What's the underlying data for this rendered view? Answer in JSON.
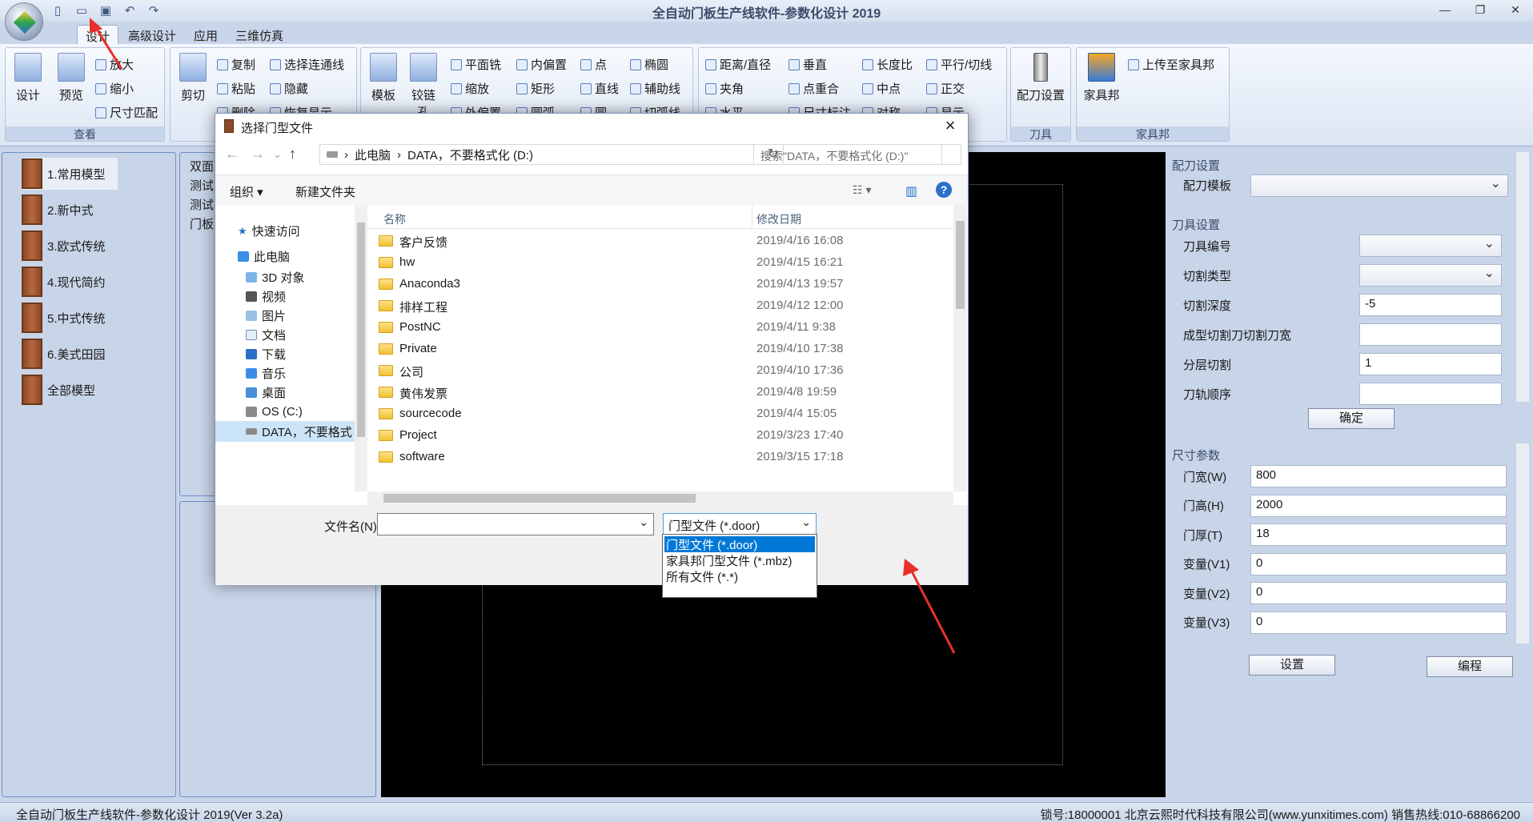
{
  "app": {
    "title": "全自动门板生产线软件-参数化设计 2019",
    "window_controls": [
      "—",
      "❐",
      "✕"
    ]
  },
  "ribbon": {
    "tabs": [
      "设计",
      "高级设计",
      "应用",
      "三维仿真"
    ],
    "groups": {
      "view": {
        "label": "查看",
        "big": [
          "设计",
          "预览"
        ],
        "small": [
          "放大",
          "缩小",
          "尺寸匹配"
        ]
      },
      "edit": {
        "big": [
          "剪切"
        ],
        "small": [
          "复制",
          "粘贴",
          "删除",
          "选择连通线",
          "隐藏",
          "恢复显示"
        ]
      },
      "draw": {
        "big": [
          "模板",
          "铰链孔"
        ],
        "small": [
          "平面铣",
          "缩放",
          "外偏置",
          "内偏置",
          "矩形",
          "圆弧",
          "点",
          "直线",
          "圆",
          "椭圆",
          "辅助线",
          "切弧线"
        ]
      },
      "measure": {
        "small": [
          "距离/直径",
          "夹角",
          "水平",
          "垂直",
          "点重合",
          "尺寸标注",
          "长度比",
          "中点",
          "对称",
          "平行/切线",
          "正交",
          "显示"
        ]
      },
      "tool": {
        "label": "刀具",
        "big": [
          "配刀设置"
        ]
      },
      "jiajubang": {
        "label": "家具邦",
        "big": [
          "家具邦"
        ],
        "small": [
          "上传至家具邦"
        ]
      }
    }
  },
  "left_panel": {
    "items": [
      "1.常用模型",
      "2.新中式",
      "3.欧式传统",
      "4.现代简约",
      "5.中式传统",
      "6.美式田园",
      "全部模型"
    ]
  },
  "mid_panel": {
    "items": [
      "双面",
      "测试",
      "测试",
      "门板"
    ]
  },
  "right_panel": {
    "knife_config": {
      "title": "配刀设置",
      "template_label": "配刀模板",
      "template_value": ""
    },
    "tool_settings": {
      "title": "刀具设置",
      "rows": [
        {
          "label": "刀具编号",
          "value": "",
          "type": "combo"
        },
        {
          "label": "切割类型",
          "value": "",
          "type": "combo"
        },
        {
          "label": "切割深度",
          "value": "-5",
          "type": "input"
        },
        {
          "label": "成型切割刀切割刀宽",
          "value": "",
          "type": "input"
        },
        {
          "label": "分层切割",
          "value": "1",
          "type": "input"
        },
        {
          "label": "刀轨顺序",
          "value": "",
          "type": "input"
        }
      ],
      "confirm": "确定"
    },
    "size_params": {
      "title": "尺寸参数",
      "rows": [
        {
          "label": "门宽(W)",
          "value": "800"
        },
        {
          "label": "门高(H)",
          "value": "2000"
        },
        {
          "label": "门厚(T)",
          "value": "18"
        },
        {
          "label": "变量(V1)",
          "value": "0"
        },
        {
          "label": "变量(V2)",
          "value": "0"
        },
        {
          "label": "变量(V3)",
          "value": "0"
        }
      ],
      "set_button": "设置",
      "program_button": "编程"
    }
  },
  "status": {
    "left": "全自动门板生产线软件-参数化设计 2019(Ver 3.2a)",
    "right": "锁号:18000001 北京云熙时代科技有限公司(www.yunxitimes.com)  销售热线:010-68866200"
  },
  "dialog": {
    "title": "选择门型文件",
    "path": [
      "此电脑",
      "DATA，不要格式化 (D:)"
    ],
    "search_placeholder": "搜索\"DATA，不要格式化 (D:)\"",
    "toolbar": {
      "organize": "组织 ▾",
      "new_folder": "新建文件夹"
    },
    "nav": {
      "quick_access": "快速访问",
      "this_pc": "此电脑",
      "items": [
        "3D 对象",
        "视频",
        "图片",
        "文档",
        "下载",
        "音乐",
        "桌面",
        "OS (C:)",
        "DATA，不要格式"
      ]
    },
    "columns": {
      "name": "名称",
      "date": "修改日期"
    },
    "files": [
      {
        "name": "客户反馈",
        "date": "2019/4/16 16:08"
      },
      {
        "name": "hw",
        "date": "2019/4/15 16:21"
      },
      {
        "name": "Anaconda3",
        "date": "2019/4/13 19:57"
      },
      {
        "name": "排样工程",
        "date": "2019/4/12 12:00"
      },
      {
        "name": "PostNC",
        "date": "2019/4/11 9:38"
      },
      {
        "name": "Private",
        "date": "2019/4/10 17:38"
      },
      {
        "name": "公司",
        "date": "2019/4/10 17:36"
      },
      {
        "name": "黄伟发票",
        "date": "2019/4/8 19:59"
      },
      {
        "name": "sourcecode",
        "date": "2019/4/4 15:05"
      },
      {
        "name": "Project",
        "date": "2019/3/23 17:40"
      },
      {
        "name": "software",
        "date": "2019/3/15 17:18"
      }
    ],
    "filename_label": "文件名(N):",
    "filename_value": "",
    "filetype_selected": "门型文件 (*.door)",
    "filetype_options": [
      "门型文件 (*.door)",
      "家具邦门型文件 (*.mbz)",
      "所有文件 (*.*)"
    ]
  },
  "colors": {
    "accent": "#0078d7",
    "annotation_arrow": "#e8302a",
    "panel_bg": "#c8d4e8",
    "canvas": "#000000"
  }
}
